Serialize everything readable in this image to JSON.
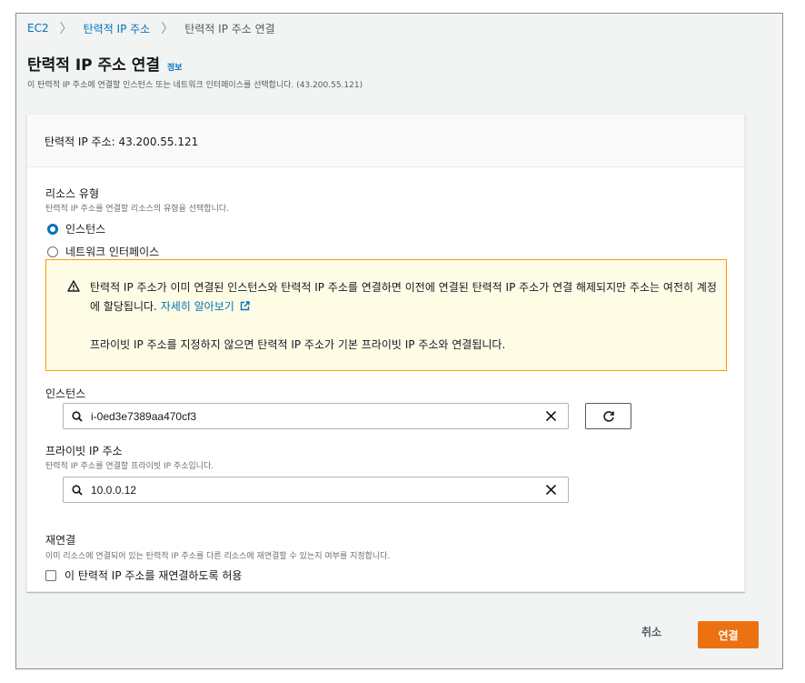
{
  "breadcrumb": {
    "items": [
      "EC2",
      "탄력적 IP 주소",
      "탄력적 IP 주소 연결"
    ]
  },
  "page": {
    "title": "탄력적 IP 주소 연결",
    "info_link": "정보",
    "subtitle": "이 탄력적 IP 주소에 연결할 인스턴스 또는 네트워크 인터페이스를 선택합니다. (43.200.55.121)"
  },
  "panel": {
    "header": "탄력적 IP 주소: 43.200.55.121"
  },
  "resource_type": {
    "label": "리소스 유형",
    "description": "탄력적 IP 주소를 연결할 리소스의 유형을 선택합니다.",
    "options": [
      {
        "label": "인스턴스",
        "selected": true
      },
      {
        "label": "네트워크 인터페이스",
        "selected": false
      }
    ]
  },
  "alert": {
    "text1": "탄력적 IP 주소가 이미 연결된 인스턴스와 탄력적 IP 주소를 연결하면 이전에 연결된 탄력적 IP 주소가 연결 해제되지만 주소는 여전히 계정에 할당됩니다.",
    "link": "자세히 알아보기",
    "text2": "프라이빗 IP 주소를 지정하지 않으면 탄력적 IP 주소가 기본 프라이빗 IP 주소와 연결됩니다."
  },
  "instance": {
    "label": "인스턴스",
    "value": "i-0ed3e7389aa470cf3"
  },
  "private_ip": {
    "label": "프라이빗 IP 주소",
    "description": "탄력적 IP 주소를 연결할 프라이빗 IP 주소입니다.",
    "value": "10.0.0.12"
  },
  "reassociation": {
    "label": "재연결",
    "description": "이미 리소스에 연결되어 있는 탄력적 IP 주소를 다른 리소스에 재연결할 수 있는지 여부를 지정합니다.",
    "checkbox_label": "이 탄력적 IP 주소를 재연결하도록 허용",
    "checked": false
  },
  "footer": {
    "cancel": "취소",
    "submit": "연결"
  },
  "colors": {
    "primary": "#ec7211",
    "link": "#0073bb",
    "alert_bg": "#fffce6",
    "alert_border": "#ff9900"
  }
}
